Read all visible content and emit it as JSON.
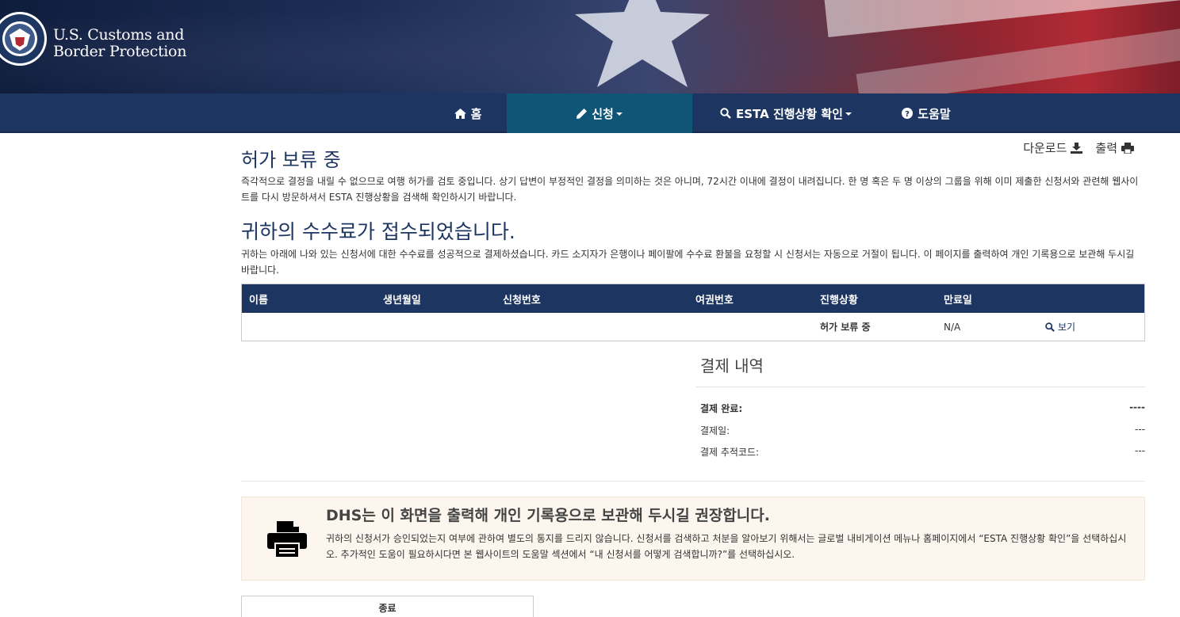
{
  "header": {
    "agency_line1": "U.S. Customs and",
    "agency_line2": "Border Protection"
  },
  "nav": {
    "items": [
      {
        "label": "홈",
        "icon": "home-icon"
      },
      {
        "label": "신청",
        "icon": "pencil-icon",
        "dropdown": true,
        "active": true
      },
      {
        "label": "ESTA 진행상황 확인",
        "icon": "search-icon",
        "dropdown": true
      },
      {
        "label": "도움말",
        "icon": "question-circle-icon"
      }
    ]
  },
  "actions": {
    "download": "다운로드",
    "print": "출력"
  },
  "status": {
    "title": "허가 보류 중",
    "description": "즉각적으로 결정을 내릴 수 없으므로 여행 허가를 검토 중입니다. 상기 답변이 부정적인 결정을 의미하는 것은 아니며, 72시간 이내에 결정이 내려집니다. 한 명 혹은 두 명 이상의 그룹을 위해 이미 제출한 신청서와 관련해 웹사이트를 다시 방문하셔서 ESTA 진행상황을 검색해 확인하시기 바랍니다."
  },
  "fee": {
    "title": "귀하의 수수료가 접수되었습니다.",
    "description": "귀하는 아래에 나와 있는 신청서에 대한 수수료를 성공적으로 결제하셨습니다. 카드 소지자가 은행이나 페이팔에 수수료 환불을 요청할 시 신청서는 자동으로 거절이 됩니다. 이 페이지를 출력하여 개인 기록용으로 보관해 두시길 바랍니다."
  },
  "table": {
    "headers": {
      "name": "이름",
      "dob": "생년월일",
      "app_no": "신청번호",
      "passport": "여권번호",
      "status": "진행상황",
      "expiry": "만료일"
    },
    "rows": [
      {
        "status": "허가 보류 중",
        "expiry": "N/A",
        "view": "보기"
      }
    ]
  },
  "payment": {
    "title": "결제 내역",
    "completed_label": "결제 완료:",
    "completed_value": "----",
    "date_label": "결제일:",
    "date_value": "---",
    "tracking_label": "결제 추적코드:",
    "tracking_value": "---"
  },
  "notice": {
    "title": "DHS는 이 화면을 출력해 개인 기록용으로 보관해 두시길 권장합니다.",
    "text": "귀하의 신청서가 승인되었는지 여부에 관하여 별도의 통지를 드리지 않습니다. 신청서를 검색하고 처분을 알아보기 위해서는 글로벌 내비게이션 메뉴나 홈페이지에서 “ESTA 진행상황 확인”을 선택하십시오. 추가적인 도움이 필요하시다면 본 웹사이트의 도움말 섹션에서 “내 신청서를 어떻게 검색합니까?”를 선택하십시오."
  },
  "close_button": "종료",
  "colors": {
    "navy": "#1d3561",
    "nav_active": "#0f5576",
    "notice_bg": "#fcf6ee"
  }
}
